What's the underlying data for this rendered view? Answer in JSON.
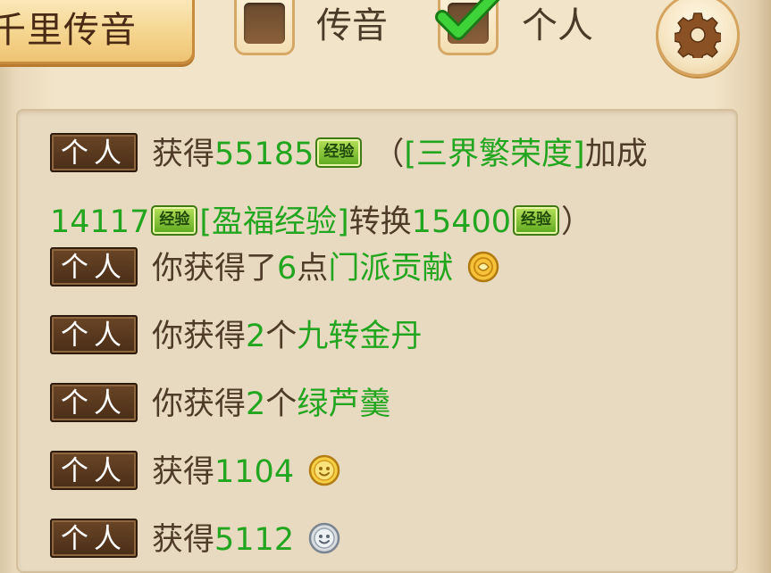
{
  "header": {
    "channel_button_label": "千里传音",
    "filters": [
      {
        "label": "传音",
        "checked": false
      },
      {
        "label": "个人",
        "checked": true
      }
    ],
    "settings_icon": "gear-icon"
  },
  "colors": {
    "highlight_green": "#22a51f",
    "text_brown": "#4e3b28",
    "tag_brown": "#5a3a1f",
    "panel_bg": "#e8dac1"
  },
  "messages": [
    {
      "tag": "个人",
      "parts": {
        "p1": "获得",
        "p2": "55185",
        "p3": "经验",
        "p4": "（",
        "p5": "[三界繁荣度]",
        "p6": "加成",
        "p7": "14117",
        "p8": "经验",
        "p9": "[盈福经验]",
        "p10": "转换",
        "p11": "15400",
        "p12": "经验",
        "p13": "）"
      }
    },
    {
      "tag": "个人",
      "parts": {
        "p1": "你获得了",
        "p2": "6",
        "p3": "点",
        "p4": "门派贡献"
      },
      "icon": "contribution-coin-icon"
    },
    {
      "tag": "个人",
      "parts": {
        "p1": "你获得",
        "p2": "2",
        "p3": "个",
        "p4": "九转金丹"
      }
    },
    {
      "tag": "个人",
      "parts": {
        "p1": "你获得",
        "p2": "2",
        "p3": "个",
        "p4": "绿芦羹"
      }
    },
    {
      "tag": "个人",
      "parts": {
        "p1": "获得",
        "p2": "1104"
      },
      "icon": "gold-coin-icon"
    },
    {
      "tag": "个人",
      "parts": {
        "p1": "获得",
        "p2": "5112"
      },
      "icon": "silver-coin-icon"
    }
  ]
}
